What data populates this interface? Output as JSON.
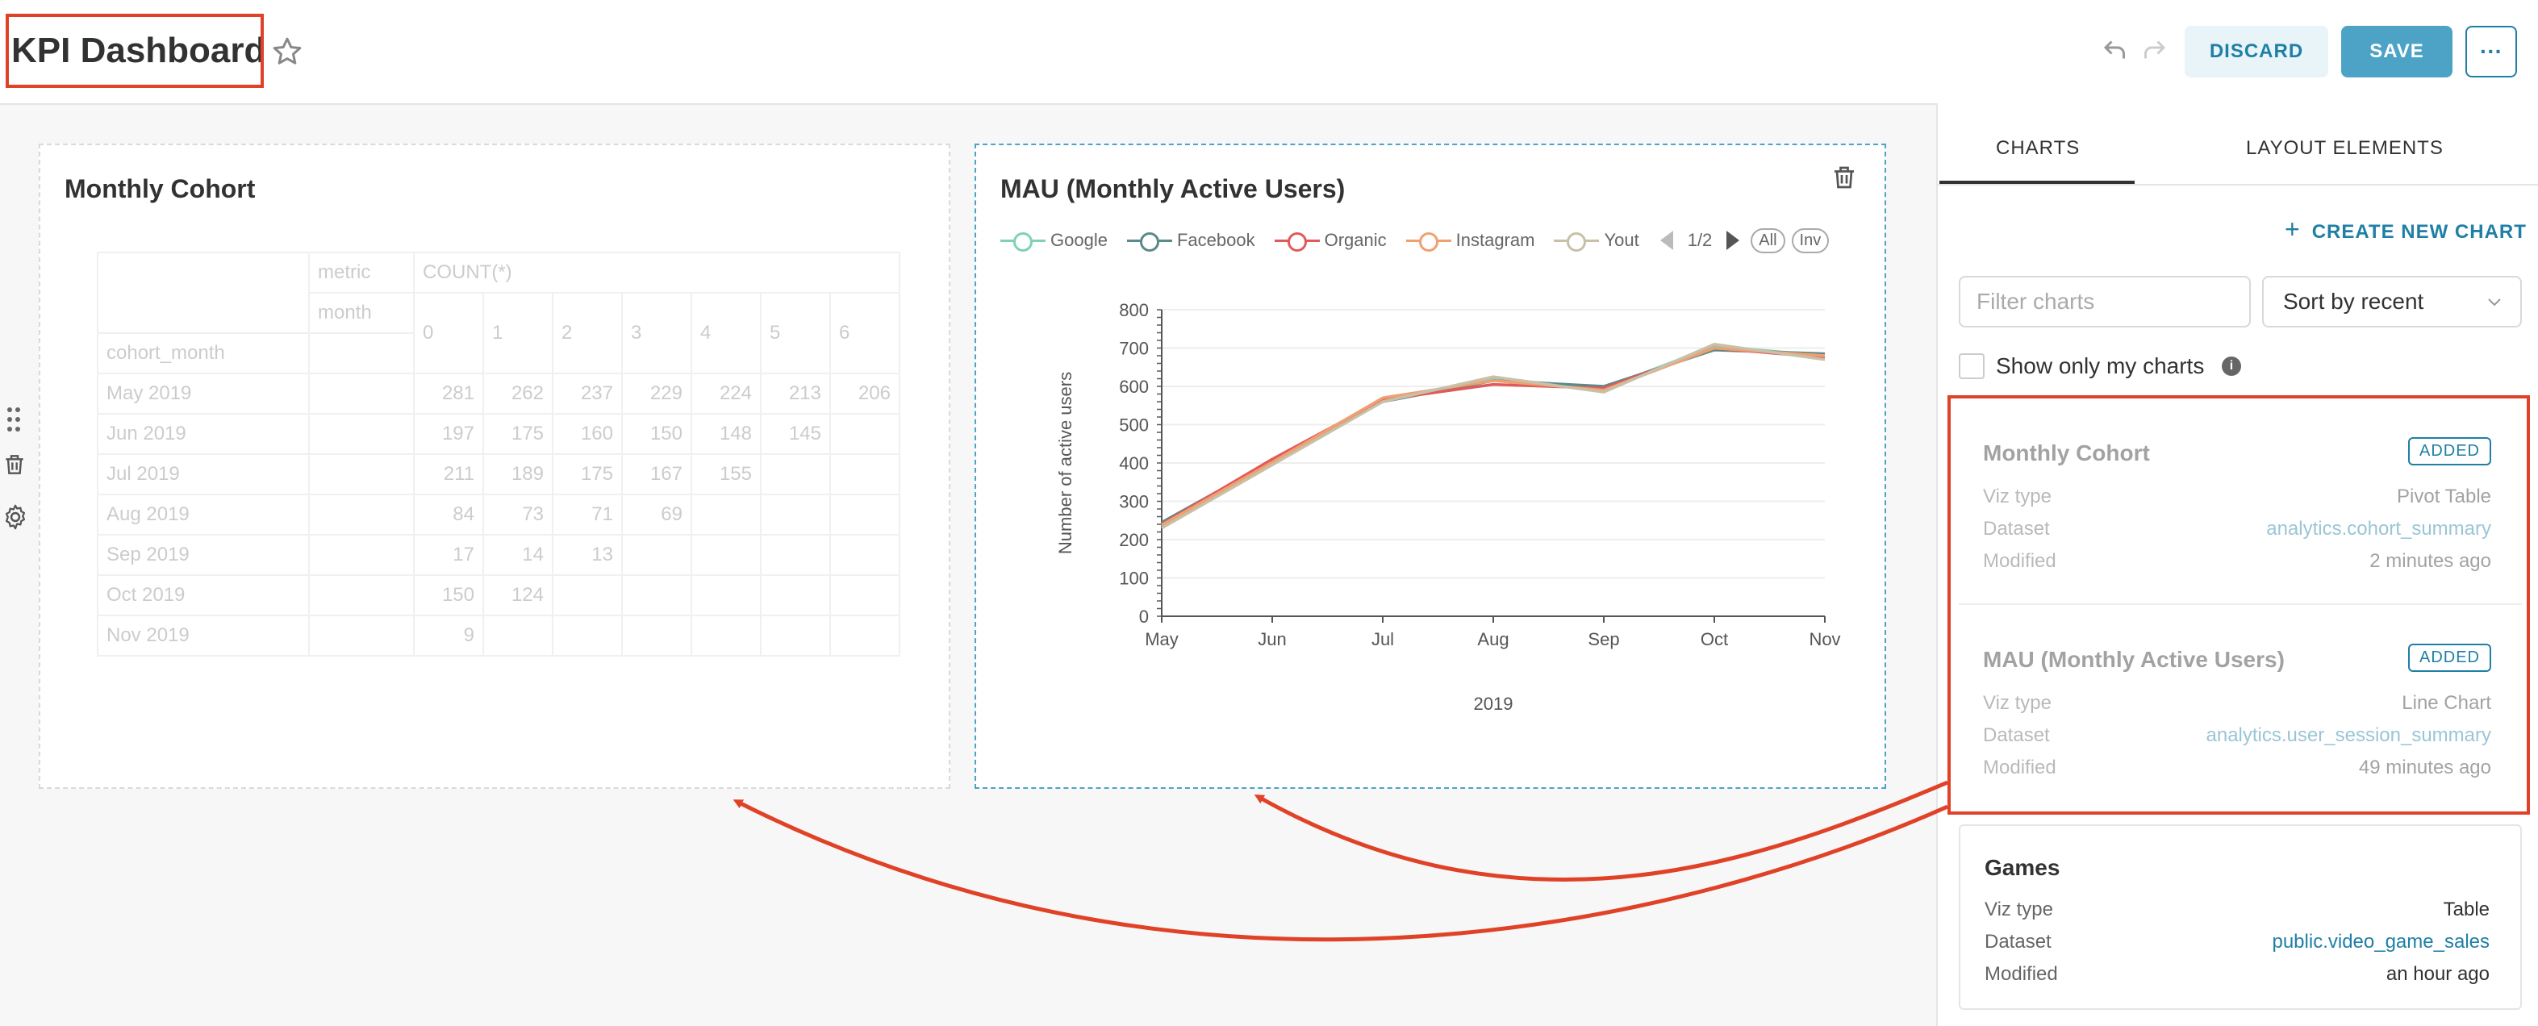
{
  "header": {
    "title": "KPI Dashboard",
    "discard_label": "DISCARD",
    "save_label": "SAVE",
    "more_label": "···"
  },
  "cards": {
    "cohort": {
      "title": "Monthly Cohort",
      "header_metric_label": "metric",
      "header_metric_value": "COUNT(*)",
      "header_month_label": "month",
      "row_header_label": "cohort_month",
      "columns": [
        "0",
        "1",
        "2",
        "3",
        "4",
        "5",
        "6"
      ],
      "rows": [
        {
          "label": "May 2019",
          "values": [
            "281",
            "262",
            "237",
            "229",
            "224",
            "213",
            "206"
          ]
        },
        {
          "label": "Jun 2019",
          "values": [
            "197",
            "175",
            "160",
            "150",
            "148",
            "145",
            ""
          ]
        },
        {
          "label": "Jul 2019",
          "values": [
            "211",
            "189",
            "175",
            "167",
            "155",
            "",
            ""
          ]
        },
        {
          "label": "Aug 2019",
          "values": [
            "84",
            "73",
            "71",
            "69",
            "",
            "",
            ""
          ]
        },
        {
          "label": "Sep 2019",
          "values": [
            "17",
            "14",
            "13",
            "",
            "",
            "",
            ""
          ]
        },
        {
          "label": "Oct 2019",
          "values": [
            "150",
            "124",
            "",
            "",
            "",
            "",
            ""
          ]
        },
        {
          "label": "Nov 2019",
          "values": [
            "9",
            "",
            "",
            "",
            "",
            "",
            ""
          ]
        }
      ]
    },
    "mau": {
      "title": "MAU (Monthly Active Users)",
      "legend_page": "1/2",
      "legend_all": "All",
      "legend_inv": "Inv"
    }
  },
  "chart_data": {
    "type": "line",
    "x": [
      "May",
      "Jun",
      "Jul",
      "Aug",
      "Sep",
      "Oct",
      "Nov"
    ],
    "xlabel": "2019",
    "ylabel": "Number of active users",
    "ylim": [
      0,
      800
    ],
    "yticks": [
      "0",
      "100",
      "200",
      "300",
      "400",
      "500",
      "600",
      "700",
      "800"
    ],
    "legend_position": "top",
    "series": [
      {
        "name": "Google",
        "color": "#7fd1b9",
        "values": [
          235,
          400,
          565,
          620,
          595,
          705,
          680
        ]
      },
      {
        "name": "Facebook",
        "color": "#5a8a8a",
        "values": [
          245,
          405,
          560,
          615,
          600,
          695,
          685
        ]
      },
      {
        "name": "Organic",
        "color": "#e05a5a",
        "values": [
          240,
          410,
          565,
          605,
          595,
          700,
          675
        ]
      },
      {
        "name": "Instagram",
        "color": "#f0a070",
        "values": [
          238,
          402,
          570,
          615,
          590,
          700,
          680
        ]
      },
      {
        "name": "Yout",
        "color": "#c8c0a8",
        "values": [
          230,
          395,
          560,
          625,
          585,
          710,
          670
        ]
      }
    ]
  },
  "sidebar": {
    "tab_charts": "CHARTS",
    "tab_layout": "LAYOUT ELEMENTS",
    "create_label": "CREATE NEW CHART",
    "filter_placeholder": "Filter charts",
    "sort_value": "Sort by recent",
    "show_mine_label": "Show only my charts",
    "items": [
      {
        "name": "Monthly Cohort",
        "badge": "ADDED",
        "viz_label": "Viz type",
        "viz": "Pivot Table",
        "ds_label": "Dataset",
        "dataset": "analytics.cohort_summary",
        "mod_label": "Modified",
        "modified": "2 minutes ago"
      },
      {
        "name": "MAU (Monthly Active Users)",
        "badge": "ADDED",
        "viz_label": "Viz type",
        "viz": "Line Chart",
        "ds_label": "Dataset",
        "dataset": "analytics.user_session_summary",
        "mod_label": "Modified",
        "modified": "49 minutes ago"
      },
      {
        "name": "Games",
        "viz_label": "Viz type",
        "viz": "Table",
        "ds_label": "Dataset",
        "dataset": "public.video_game_sales",
        "mod_label": "Modified",
        "modified": "an hour ago"
      }
    ]
  },
  "colors": {
    "accent": "#1f7fa5",
    "annotation": "#e04228"
  }
}
